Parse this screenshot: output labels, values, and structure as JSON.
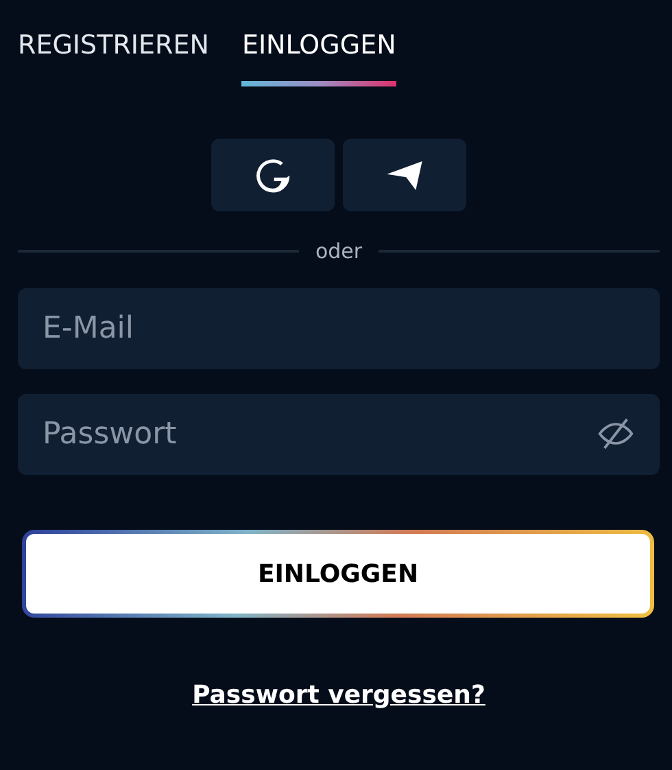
{
  "tabs": [
    {
      "label": "REGISTRIEREN",
      "selected": false
    },
    {
      "label": "EINLOGGEN",
      "selected": true
    }
  ],
  "social_buttons": [
    {
      "kind": "google"
    },
    {
      "kind": "telegram"
    }
  ],
  "divider": "oder",
  "fields": [
    {
      "placeholder": "E-Mail",
      "kind": "text"
    },
    {
      "placeholder": "Passwort",
      "kind": "password"
    }
  ],
  "submit": "EINLOGGEN",
  "forgot_link": "Passwort vergessen?"
}
